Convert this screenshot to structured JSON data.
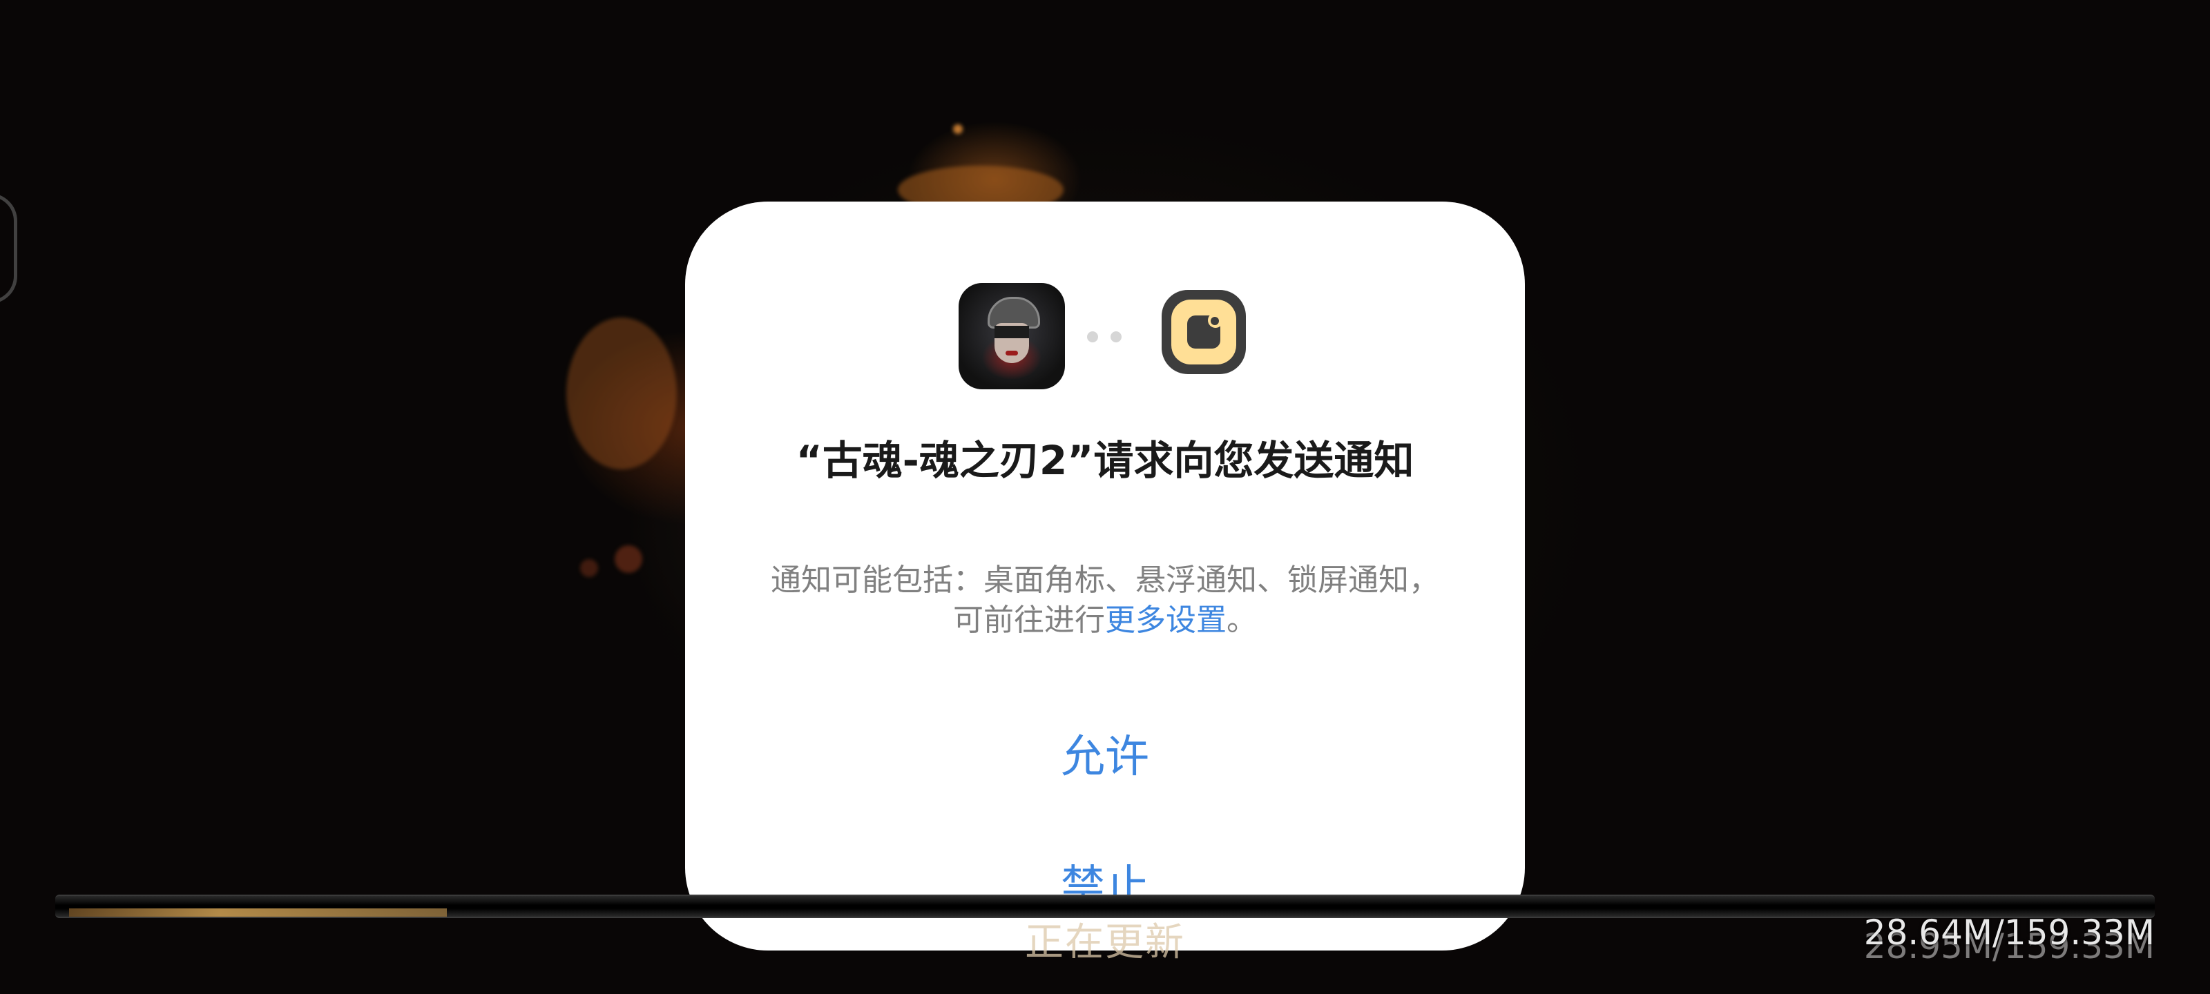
{
  "dialog": {
    "title": "“古魂-魂之刃2”请求向您发送通知",
    "description_prefix": "通知可能包括：桌面角标、悬浮通知、锁屏通知，可前往进行",
    "description_link": "更多设置",
    "description_suffix": "。",
    "allow_label": "允许",
    "deny_label": "禁止",
    "app_icon": "game-app-icon",
    "notification_icon": "notification-bell-icon"
  },
  "game_overlay": {
    "status_text": "正在更新",
    "download_size": "28.64M/159.33M",
    "download_size_ghost": "28.95M/159.33M",
    "progress": 0.18
  },
  "colors": {
    "link": "#3d86e0",
    "notification_icon_bg": "#ffdf96",
    "dialog_bg": "#ffffff"
  }
}
